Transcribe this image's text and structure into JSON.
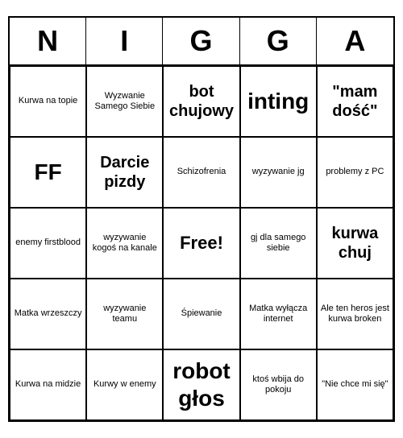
{
  "header": {
    "letters": [
      "N",
      "I",
      "G",
      "G",
      "A"
    ]
  },
  "cells": [
    {
      "text": "Kurwa na topie",
      "size": "small"
    },
    {
      "text": "Wyzwanie Samego Siebie",
      "size": "small"
    },
    {
      "text": "bot chujowy",
      "size": "medium"
    },
    {
      "text": "inting",
      "size": "large"
    },
    {
      "text": "\"mam dość\"",
      "size": "medium"
    },
    {
      "text": "FF",
      "size": "large"
    },
    {
      "text": "Darcie pizdy",
      "size": "medium"
    },
    {
      "text": "Schizofrenia",
      "size": "small"
    },
    {
      "text": "wyzywanie jg",
      "size": "small"
    },
    {
      "text": "problemy z PC",
      "size": "small"
    },
    {
      "text": "enemy firstblood",
      "size": "small"
    },
    {
      "text": "wyzywanie kogoś na kanale",
      "size": "small"
    },
    {
      "text": "Free!",
      "size": "free"
    },
    {
      "text": "gj dla samego siebie",
      "size": "small"
    },
    {
      "text": "kurwa chuj",
      "size": "medium"
    },
    {
      "text": "Matka wrzeszczy",
      "size": "small"
    },
    {
      "text": "wyzywanie teamu",
      "size": "small"
    },
    {
      "text": "Śpiewanie",
      "size": "small"
    },
    {
      "text": "Matka wyłącza internet",
      "size": "small"
    },
    {
      "text": "Ale ten heros jest kurwa broken",
      "size": "small"
    },
    {
      "text": "Kurwa na midzie",
      "size": "small"
    },
    {
      "text": "Kurwy w enemy",
      "size": "small"
    },
    {
      "text": "robot głos",
      "size": "large"
    },
    {
      "text": "ktoś wbija do pokoju",
      "size": "small"
    },
    {
      "text": "\"Nie chce mi się\"",
      "size": "small"
    }
  ]
}
